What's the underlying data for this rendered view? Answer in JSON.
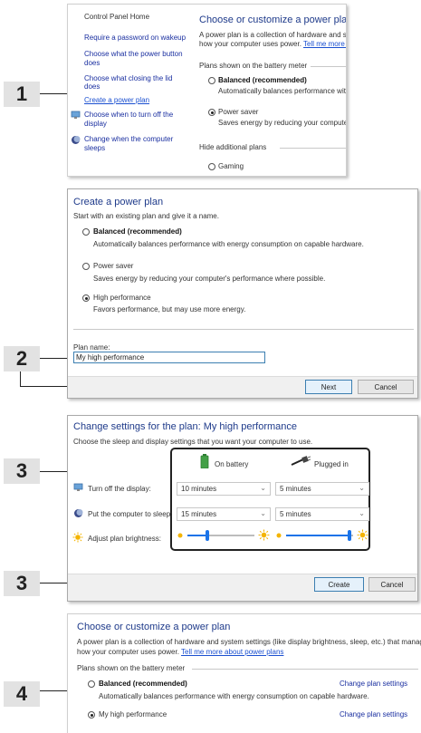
{
  "steps": [
    "1",
    "2",
    "3",
    "3",
    "4"
  ],
  "panel1": {
    "control_panel_home": "Control Panel Home",
    "side_links": [
      "Require a password on wakeup",
      "Choose what the power button",
      "does",
      "Choose what closing the lid",
      "does",
      "Create a power plan",
      "Choose when to turn off the",
      "display",
      "Change when the computer",
      "sleeps"
    ],
    "title": "Choose or customize a power plan",
    "desc_line1": "A power plan is a collection of hardware and sy",
    "desc_line2": "how your computer uses power.",
    "tell_me_more": "Tell me more a",
    "plans_shown": "Plans shown on the battery meter",
    "balanced": "Balanced (recommended)",
    "balanced_desc": "Automatically balances performance with",
    "power_saver": "Power saver",
    "power_saver_desc": "Saves energy by reducing your computer",
    "hide_plans": "Hide additional plans",
    "gaming": "Gaming"
  },
  "panel2": {
    "title": "Create a power plan",
    "intro": "Start with an existing plan and give it a name.",
    "balanced": "Balanced (recommended)",
    "balanced_desc": "Automatically balances performance with energy consumption on capable hardware.",
    "power_saver": "Power saver",
    "power_saver_desc": "Saves energy by reducing your computer's performance where possible.",
    "high_perf": "High performance",
    "high_perf_desc": "Favors performance, but may use more energy.",
    "plan_name_label": "Plan name:",
    "plan_name_value": "My high performance",
    "next": "Next",
    "cancel": "Cancel"
  },
  "panel3": {
    "title": "Change settings for the plan: My high performance",
    "intro": "Choose the sleep and display settings that you want your computer to use.",
    "on_battery": "On battery",
    "plugged_in": "Plugged in",
    "turn_off_display": "Turn off the display:",
    "sleep": "Put the computer to sleep:",
    "brightness": "Adjust plan brightness:",
    "display_battery": "10 minutes",
    "display_plugged": "5 minutes",
    "sleep_battery": "15 minutes",
    "sleep_plugged": "5 minutes",
    "brightness_battery": 0.3,
    "brightness_plugged": 0.95,
    "create": "Create",
    "cancel": "Cancel"
  },
  "panel4": {
    "title": "Choose or customize a power plan",
    "desc_line1": "A power plan is a collection of hardware and system settings (like display brightness, sleep, etc.) that manages",
    "desc_line2": "how your computer uses power.",
    "tell_me_more": "Tell me more about power plans",
    "plans_shown": "Plans shown on the battery meter",
    "balanced": "Balanced (recommended)",
    "balanced_desc": "Automatically balances performance with energy consumption on capable hardware.",
    "change_settings_1": "Change plan settings",
    "my_high_perf": "My high performance",
    "change_settings_2": "Change plan settings"
  },
  "colors": {
    "accent": "#1e3a8a",
    "link": "#1a2fa0",
    "slider": "#1a73e8"
  },
  "icons": [
    "monitor-icon",
    "moon-icon",
    "sun-icon",
    "battery-icon",
    "plug-icon"
  ]
}
